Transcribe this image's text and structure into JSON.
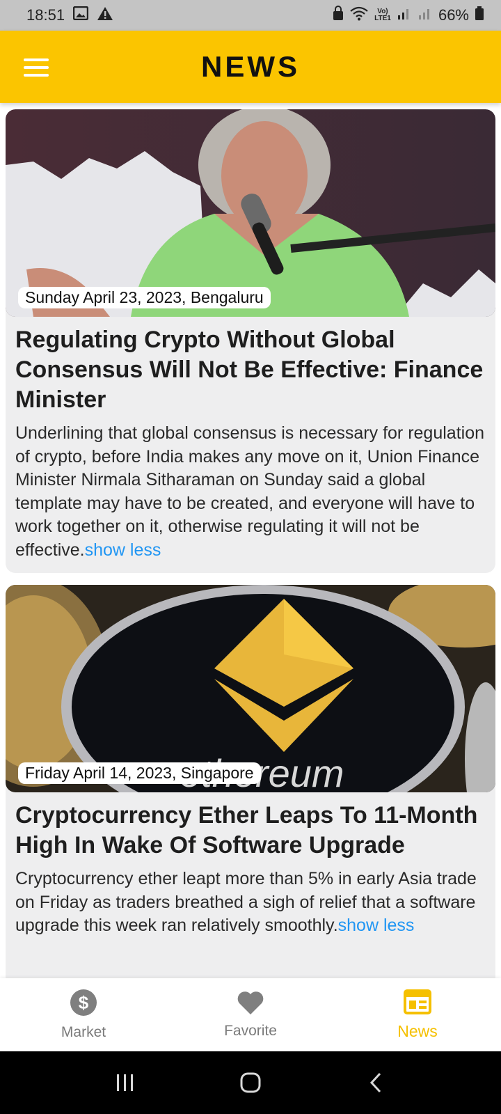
{
  "status_bar": {
    "time": "18:51",
    "battery": "66%",
    "icons_left": [
      "image-icon",
      "warning-icon"
    ],
    "icons_right": [
      "lock-icon",
      "wifi-icon",
      "volte-icon",
      "signal-icon",
      "signal-icon",
      "battery-icon"
    ],
    "network_label": "Vo) LTE1"
  },
  "app_bar": {
    "title": "NEWS",
    "background": "#fbc500"
  },
  "articles": [
    {
      "date_location": "Sunday April 23, 2023, Bengaluru",
      "title": "Regulating Crypto Without Global Consensus Will Not Be Effective: Finance Minister",
      "body": "Underlining that global consensus is necessary for regulation of crypto, before India makes any move on it, Union Finance Minister Nirmala Sitharaman on Sunday said a global template may have to be created, and everyone will have to work together on it, otherwise regulating it will not be effective.",
      "toggle": "show less"
    },
    {
      "date_location": "Friday April 14, 2023, Singapore",
      "title": "Cryptocurrency Ether Leaps To 11-Month High In Wake Of Software Upgrade",
      "body": "Cryptocurrency ether leapt more than 5% in early Asia trade on Friday as traders breathed a sigh of relief that a software upgrade this week ran relatively smoothly.",
      "toggle": "show less"
    }
  ],
  "bottom_nav": {
    "items": [
      {
        "label": "Market",
        "icon": "dollar-icon"
      },
      {
        "label": "Favorite",
        "icon": "heart-icon"
      },
      {
        "label": "News",
        "icon": "newspaper-icon",
        "active": true
      }
    ],
    "active_color": "#f5c000",
    "inactive_color": "#7a7a7a"
  },
  "system_nav": {
    "buttons": [
      "recents-icon",
      "home-icon",
      "back-icon"
    ]
  }
}
